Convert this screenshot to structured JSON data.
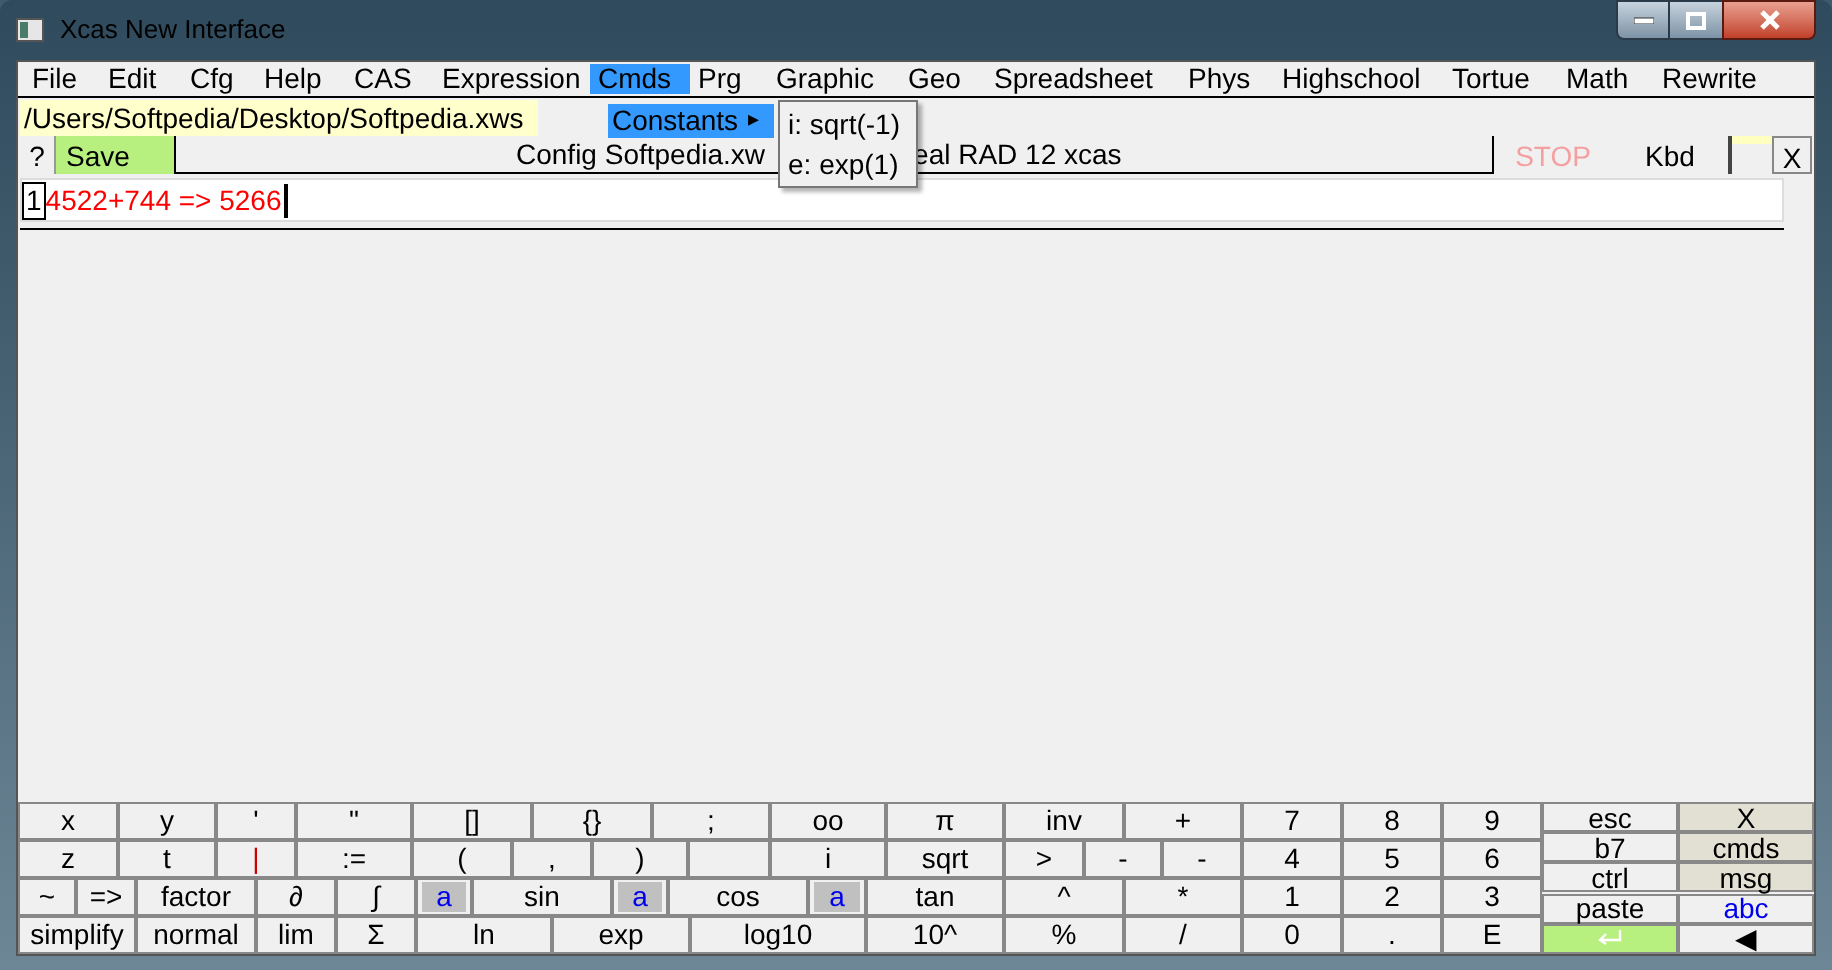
{
  "window": {
    "title": "Xcas New Interface"
  },
  "menu_bar": [
    {
      "label": "File",
      "selected": false
    },
    {
      "label": "Edit",
      "selected": false
    },
    {
      "label": "Cfg",
      "selected": false
    },
    {
      "label": "Help",
      "selected": false
    },
    {
      "label": "CAS",
      "selected": false
    },
    {
      "label": "Expression",
      "selected": false
    },
    {
      "label": "Cmds",
      "selected": true
    },
    {
      "label": "Prg",
      "selected": false
    },
    {
      "label": "Graphic",
      "selected": false
    },
    {
      "label": "Geo",
      "selected": false
    },
    {
      "label": "Spreadsheet",
      "selected": false
    },
    {
      "label": "Phys",
      "selected": false
    },
    {
      "label": "Highschool",
      "selected": false
    },
    {
      "label": "Tortue",
      "selected": false
    },
    {
      "label": "Math",
      "selected": false
    },
    {
      "label": "Rewrite",
      "selected": false
    }
  ],
  "dropdown": {
    "items": [
      {
        "label": "Constants",
        "arrow": "▸",
        "selected": true
      }
    ],
    "submenu": [
      "i: sqrt(-1)",
      "e: exp(1)"
    ]
  },
  "file_path": "/Users/Softpedia/Desktop/Softpedia.xws",
  "toolbar": {
    "help": "?",
    "save": "Save",
    "status_left": "Config Softpedia.xw",
    "status_right": "eal RAD 12 xcas",
    "stop": "STOP",
    "stop_disabled": true,
    "kbd": "Kbd",
    "close": "X"
  },
  "session": [
    {
      "index": "1",
      "content": "4522+744 => 5266"
    }
  ],
  "keypad": [
    [
      {
        "label": "x",
        "kind": "plain"
      },
      {
        "label": "y",
        "kind": "plain"
      },
      {
        "label": "'",
        "kind": "plain"
      },
      {
        "label": "\"",
        "kind": "plain"
      },
      {
        "label": "[]",
        "kind": "plain"
      },
      {
        "label": "{}",
        "kind": "plain"
      },
      {
        "label": ";",
        "kind": "plain"
      },
      {
        "label": "oo",
        "kind": "plain"
      },
      {
        "label": "π",
        "kind": "plain"
      },
      {
        "label": "inv",
        "kind": "plain"
      },
      {
        "label": "+",
        "kind": "plain"
      },
      {
        "label": "7",
        "kind": "plain"
      },
      {
        "label": "8",
        "kind": "plain"
      },
      {
        "label": "9",
        "kind": "plain"
      }
    ],
    [
      {
        "label": "z",
        "kind": "plain"
      },
      {
        "label": "t",
        "kind": "plain"
      },
      {
        "label": "|",
        "kind": "red"
      },
      {
        "label": ":=",
        "kind": "plain"
      },
      {
        "label": "(",
        "kind": "plain"
      },
      {
        "label": ",",
        "kind": "plain"
      },
      {
        "label": ")",
        "kind": "plain"
      },
      {
        "kind": "blank"
      },
      {
        "label": "i",
        "kind": "plain"
      },
      {
        "label": "sqrt",
        "kind": "plain"
      },
      {
        "label": ">",
        "kind": "plain"
      },
      {
        "label": "-",
        "kind": "plain"
      },
      {
        "label": "-",
        "kind": "plain"
      },
      {
        "label": "4",
        "kind": "plain"
      },
      {
        "label": "5",
        "kind": "plain"
      },
      {
        "label": "6",
        "kind": "plain"
      }
    ],
    [
      {
        "label": "~",
        "kind": "plain"
      },
      {
        "label": "=>",
        "kind": "plain"
      },
      {
        "label": "factor",
        "kind": "plain"
      },
      {
        "label": "∂",
        "kind": "plain"
      },
      {
        "label": "∫",
        "kind": "plain"
      },
      {
        "label": "a",
        "kind": "shaded"
      },
      {
        "label": "sin",
        "kind": "plain"
      },
      {
        "label": "a",
        "kind": "shaded"
      },
      {
        "label": "cos",
        "kind": "plain"
      },
      {
        "label": "a",
        "kind": "shaded"
      },
      {
        "label": "tan",
        "kind": "plain"
      },
      {
        "label": "^",
        "kind": "plain"
      },
      {
        "label": "*",
        "kind": "plain"
      },
      {
        "label": "1",
        "kind": "plain"
      },
      {
        "label": "2",
        "kind": "plain"
      },
      {
        "label": "3",
        "kind": "plain"
      }
    ],
    [
      {
        "label": "simplify",
        "kind": "plain"
      },
      {
        "label": "normal",
        "kind": "plain"
      },
      {
        "label": "lim",
        "kind": "plain"
      },
      {
        "label": "Σ",
        "kind": "plain"
      },
      {
        "label": "ln",
        "kind": "plain"
      },
      {
        "label": "exp",
        "kind": "plain"
      },
      {
        "label": "log10",
        "kind": "plain"
      },
      {
        "label": "10^",
        "kind": "plain"
      },
      {
        "label": "%",
        "kind": "plain"
      },
      {
        "label": "/",
        "kind": "plain"
      },
      {
        "label": "0",
        "kind": "plain"
      },
      {
        "label": ".",
        "kind": "plain"
      },
      {
        "label": "E",
        "kind": "plain"
      }
    ]
  ],
  "side_keys": [
    [
      {
        "label": "esc",
        "kind": "plain"
      },
      {
        "label": "X",
        "kind": "tan"
      }
    ],
    [
      {
        "label": "b7",
        "kind": "plain"
      },
      {
        "label": "cmds",
        "kind": "tan"
      }
    ],
    [
      {
        "label": "ctrl",
        "kind": "plain"
      },
      {
        "label": "msg",
        "kind": "tan"
      }
    ],
    [
      {
        "label": "paste",
        "kind": "plain"
      },
      {
        "label": "abc",
        "kind": "blue"
      }
    ],
    [
      {
        "kind": "enter"
      },
      {
        "label": "◀",
        "kind": "plain"
      }
    ]
  ]
}
